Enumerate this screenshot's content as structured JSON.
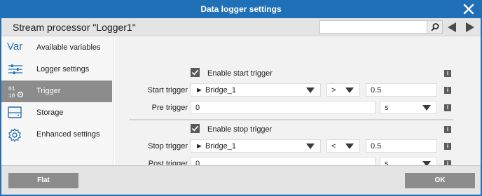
{
  "window": {
    "title": "Data logger settings"
  },
  "header": {
    "heading": "Stream processor \"Logger1\"",
    "search_value": ""
  },
  "sidebar": {
    "items": [
      {
        "label": "Available variables",
        "icon": "var-icon",
        "icon_text": "Var"
      },
      {
        "label": "Logger settings",
        "icon": "sliders-icon"
      },
      {
        "label": "Trigger",
        "icon": "trigger-icon",
        "active": true
      },
      {
        "label": "Storage",
        "icon": "storage-icon"
      },
      {
        "label": "Enhanced settings",
        "icon": "gear-icon"
      }
    ]
  },
  "start": {
    "enable_label": "Enable start trigger",
    "trigger_label": "Start trigger",
    "trigger_source": "► Bridge_1",
    "operator": ">",
    "value": "0.5",
    "pre_label": "Pre trigger",
    "pre_value": "0",
    "pre_unit": "s"
  },
  "stop": {
    "enable_label": "Enable stop trigger",
    "trigger_label": "Stop trigger",
    "trigger_source": "► Bridge_1",
    "operator": "<",
    "value": "0.5",
    "post_label": "Post trigger",
    "post_value": "0",
    "post_unit": "s"
  },
  "info_glyph": "i",
  "footer": {
    "left_button": "Flat",
    "right_button": "OK"
  },
  "colors": {
    "accent": "#1f70b7",
    "active_item": "#8c8c8c",
    "panel": "#f2f2f2"
  }
}
